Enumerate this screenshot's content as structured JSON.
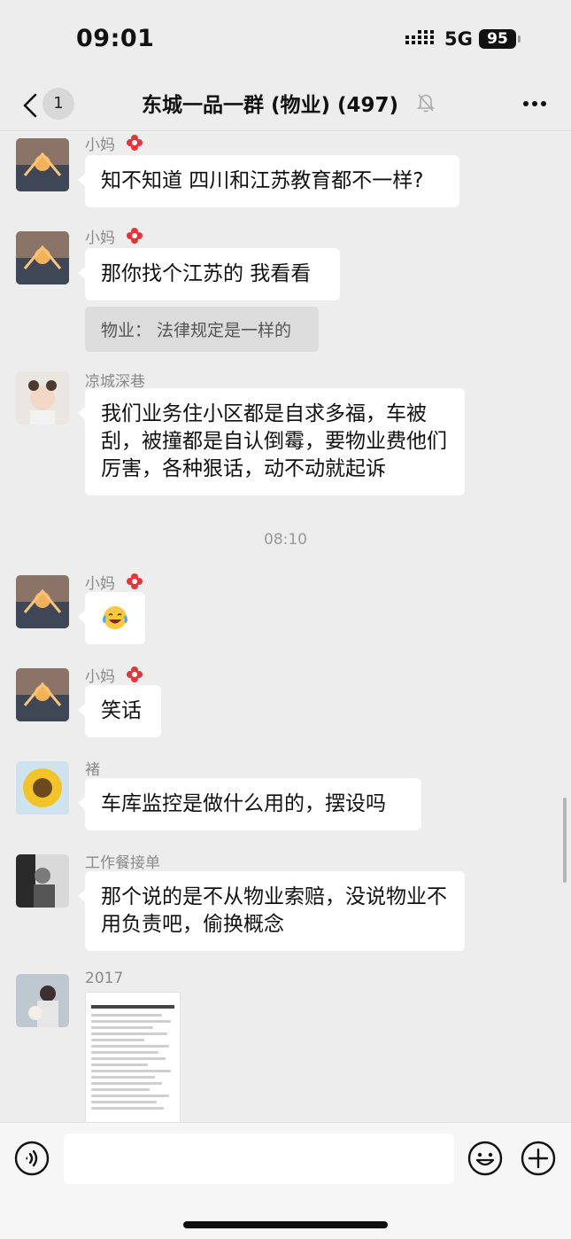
{
  "status_bar": {
    "time": "09:01",
    "network": "5G",
    "battery": "95"
  },
  "nav": {
    "unread_count": "1",
    "title": "东城一品一群 (物业) (497)",
    "icons": {
      "back": "chevron-left-icon",
      "mute": "bell-muted-icon",
      "more": "more-dots-icon"
    }
  },
  "messages": [
    {
      "sender": "小妈",
      "text": "知不知道 四川和江苏教育都不一样?"
    },
    {
      "sender": "小妈",
      "text": "那你找个江苏的 我看看",
      "quote": "物业： 法律规定是一样的"
    },
    {
      "sender": "凉城深巷",
      "text": "我们业务住小区都是自求多福，车被刮，被撞都是自认倒霉，要物业费他们厉害，各种狠话，动不动就起诉"
    },
    {
      "time_separator": "08:10"
    },
    {
      "sender": "小妈",
      "emoji": "laughing-crying-emoji"
    },
    {
      "sender": "小妈",
      "text": "笑话"
    },
    {
      "sender": "褚",
      "text": "车库监控是做什么用的，摆设吗"
    },
    {
      "sender": "工作餐接单",
      "text": "那个说的是不从物业索赔，没说物业不用负责吧，偷换概念"
    },
    {
      "sender": "2017",
      "attachment": "screenshot-image"
    }
  ],
  "input_bar": {
    "placeholder": "",
    "icons": [
      "voice-icon",
      "emoji-icon",
      "plus-icon"
    ]
  },
  "colors": {
    "background": "#ededed",
    "bubble": "#ffffff",
    "quote": "#dcdcdc",
    "sender": "#8a8a8a"
  }
}
